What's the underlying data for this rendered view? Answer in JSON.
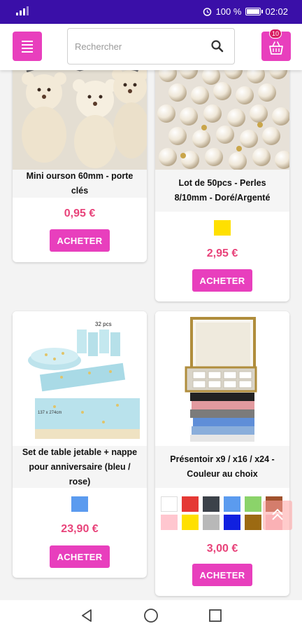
{
  "status_bar": {
    "battery": "100 %",
    "time": "02:02",
    "icons": [
      "signal-icon",
      "alarm-icon",
      "battery-icon"
    ]
  },
  "header": {
    "menu_icon": "menu-icon",
    "search_placeholder": "Rechercher",
    "search_icon": "search-icon",
    "cart_icon": "basket-icon",
    "cart_count": "10"
  },
  "products": [
    {
      "title": "Mini ourson 60mm - porte clés",
      "price": "0,95 €",
      "buy_label": "ACHETER",
      "colors": []
    },
    {
      "title": "Lot de 50pcs - Perles 8/10mm - Doré/Argenté",
      "price": "2,95 €",
      "buy_label": "ACHETER",
      "colors": [
        "#ffe000"
      ]
    },
    {
      "title": "Set de table jetable + nappe pour anniversaire (bleu / rose)",
      "price": "23,90 €",
      "buy_label": "ACHETER",
      "colors": [
        "#5b9bef"
      ],
      "image_text": {
        "box": "32 pcs",
        "cloth": "137 x 274cm"
      }
    },
    {
      "title": "Présentoir x9 / x16 / x24 - Couleur au choix",
      "price": "3,00 €",
      "buy_label": "ACHETER",
      "colors": [
        "#ffffff",
        "#e53935",
        "#3c424a",
        "#5b9bef",
        "#8bd36a",
        "#a0522d",
        "#ffc6cf",
        "#ffe000",
        "#b8b8b8",
        "#1020e0",
        "#9c6a12",
        "#f4c6cf"
      ]
    }
  ],
  "scroll_top_icon": "chevron-up-icon",
  "nav_bar": {
    "icons": [
      "back-icon",
      "home-icon",
      "recents-icon"
    ]
  },
  "colors": {
    "accent": "#e83fbd",
    "price": "#e8437a",
    "status_bar": "#3a0fa8"
  }
}
